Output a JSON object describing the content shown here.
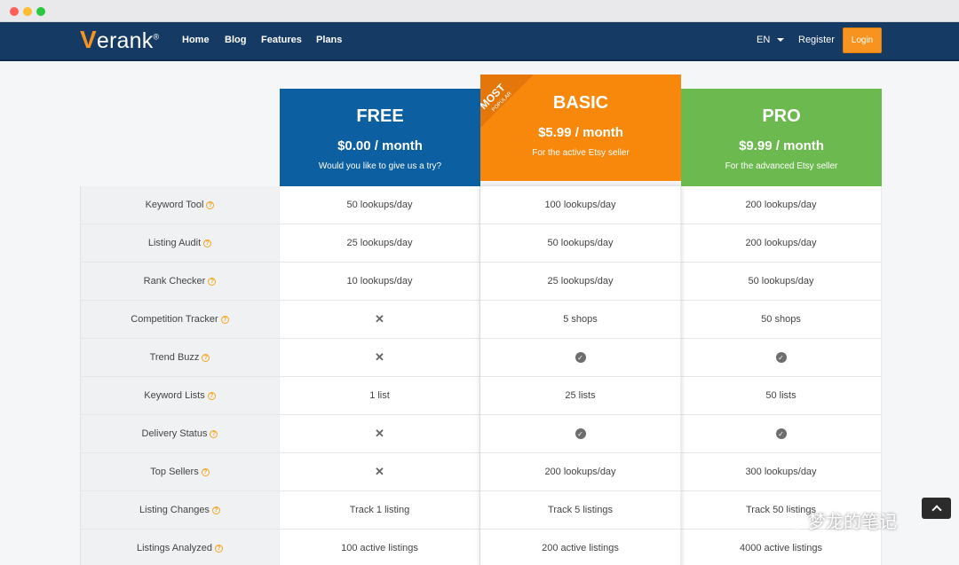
{
  "nav": {
    "logo": {
      "v": "V",
      "rest": "erank",
      "reg": "®"
    },
    "links": [
      "Home",
      "Blog",
      "Features",
      "Plans"
    ],
    "lang": "EN",
    "register": "Register",
    "login": "Login"
  },
  "plans": [
    {
      "name": "FREE",
      "price": "$0.00 / month",
      "desc": "Would you like to give us a try?",
      "color": "#0c5fa0"
    },
    {
      "name": "BASIC",
      "price": "$5.99 / month",
      "desc": "For the active Etsy seller",
      "color": "#f7880c",
      "ribbon_top": "MOST",
      "ribbon_bottom": "POPULAR"
    },
    {
      "name": "PRO",
      "price": "$9.99 / month",
      "desc": "For the advanced Etsy seller",
      "color": "#6cb94f"
    }
  ],
  "features": [
    {
      "label": "Keyword Tool",
      "free": "50 lookups/day",
      "basic": "100 lookups/day",
      "pro": "200 lookups/day"
    },
    {
      "label": "Listing Audit",
      "free": "25 lookups/day",
      "basic": "50 lookups/day",
      "pro": "200 lookups/day"
    },
    {
      "label": "Rank Checker",
      "free": "10 lookups/day",
      "basic": "25 lookups/day",
      "pro": "50 lookups/day"
    },
    {
      "label": "Competition Tracker",
      "free": "x-icon",
      "basic": "5 shops",
      "pro": "50 shops"
    },
    {
      "label": "Trend Buzz",
      "free": "x-icon",
      "basic": "check-icon",
      "pro": "check-icon"
    },
    {
      "label": "Keyword Lists",
      "free": "1 list",
      "basic": "25 lists",
      "pro": "50 lists"
    },
    {
      "label": "Delivery Status",
      "free": "x-icon",
      "basic": "check-icon",
      "pro": "check-icon"
    },
    {
      "label": "Top Sellers",
      "free": "x-icon",
      "basic": "200 lookups/day",
      "pro": "300 lookups/day"
    },
    {
      "label": "Listing Changes",
      "free": "Track 1 listing",
      "basic": "Track 5 listings",
      "pro": "Track 50 listings"
    },
    {
      "label": "Listings Analyzed",
      "free": "100 active listings",
      "basic": "200 active listings",
      "pro": "4000 active listings"
    }
  ],
  "help_icon": "question-circle-icon",
  "watermark": "梦龙的笔记",
  "colors": {
    "navbar": "#153a63",
    "accent": "#f7931e",
    "help": "#f5a623"
  }
}
